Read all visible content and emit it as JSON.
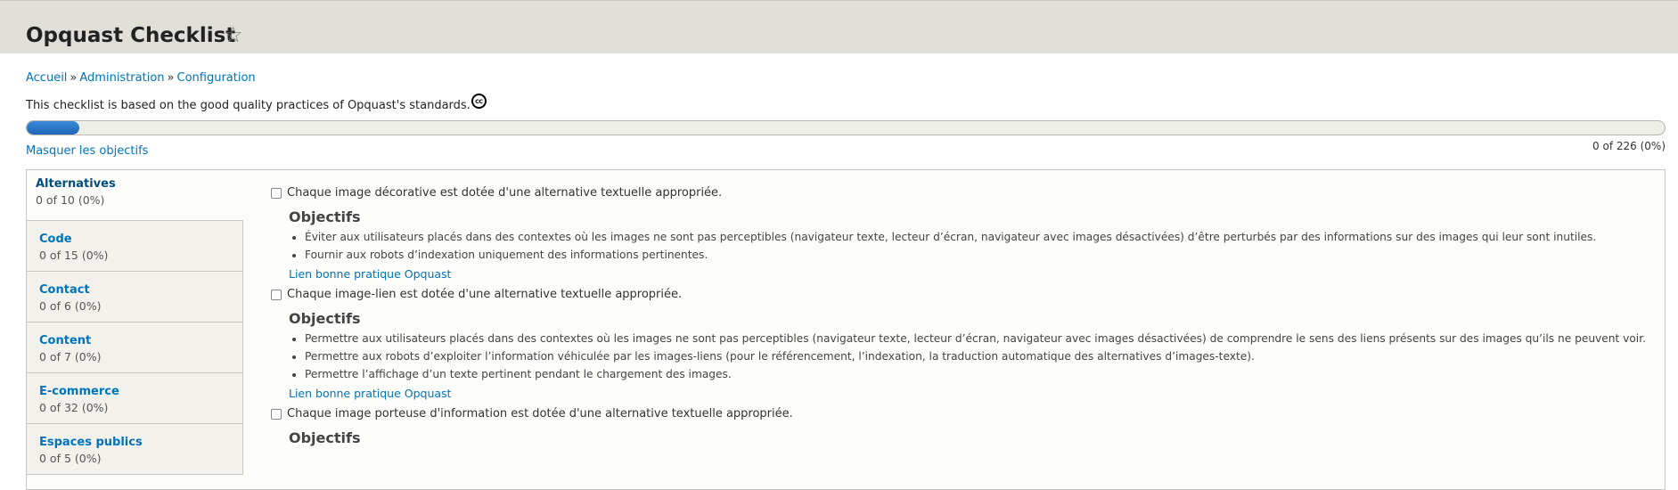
{
  "header": {
    "title": "Opquast Checklist",
    "star_icon": "star-icon"
  },
  "breadcrumb": [
    "Accueil",
    "Administration",
    "Configuration"
  ],
  "breadcrumb_sep": "»",
  "intro": "This checklist is based on the good quality practices of Opquast's standards.",
  "cc_label": "cc",
  "progress": {
    "fraction": 0.0,
    "count_text": "0 of 226 (0%)"
  },
  "toggle_objectives": "Masquer les objectifs",
  "tabs": [
    {
      "label": "Alternatives",
      "summary": "0 of 10 (0%)"
    },
    {
      "label": "Code",
      "summary": "0 of 15 (0%)"
    },
    {
      "label": "Contact",
      "summary": "0 of 6 (0%)"
    },
    {
      "label": "Content",
      "summary": "0 of 7 (0%)"
    },
    {
      "label": "E-commerce",
      "summary": "0 of 32 (0%)"
    },
    {
      "label": "Espaces publics",
      "summary": "0 of 5 (0%)"
    }
  ],
  "items": [
    {
      "label": "Chaque image décorative est dotée d'une alternative textuelle appropriée.",
      "objectives_title": "Objectifs",
      "objectives": [
        "Éviter aux utilisateurs placés dans des contextes où les images ne sont pas perceptibles (navigateur texte, lecteur d’écran, navigateur avec images désactivées) d’être perturbés par des informations sur des images qui leur sont inutiles.",
        "Fournir aux robots d’indexation uniquement des informations pertinentes."
      ],
      "link": "Lien bonne pratique Opquast"
    },
    {
      "label": "Chaque image-lien est dotée d'une alternative textuelle appropriée.",
      "objectives_title": "Objectifs",
      "objectives": [
        "Permettre aux utilisateurs placés dans des contextes où les images ne sont pas perceptibles (navigateur texte, lecteur d’écran, navigateur avec images désactivées) de comprendre le sens des liens présents sur des images qu’ils ne peuvent voir.",
        "Permettre aux robots d’exploiter l’information véhiculée par les images-liens (pour le référencement, l’indexation, la traduction automatique des alternatives d’images-texte).",
        "Permettre l’affichage d’un texte pertinent pendant le chargement des images."
      ],
      "link": "Lien bonne pratique Opquast"
    },
    {
      "label": "Chaque image porteuse d'information est dotée d'une alternative textuelle appropriée.",
      "objectives_title": "Objectifs",
      "objectives": [],
      "link": ""
    }
  ]
}
